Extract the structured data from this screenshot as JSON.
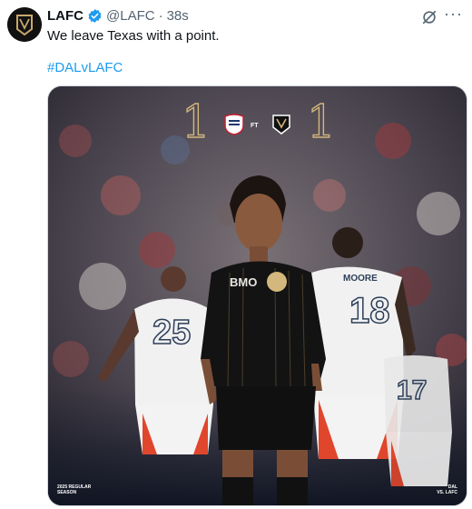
{
  "tweet": {
    "display_name": "LAFC",
    "handle": "@LAFC",
    "separator": "·",
    "time": "38s",
    "text": "We leave Texas with a point.",
    "hashtag": "#DALvLAFC",
    "icons": {
      "avatar": "lafc-logo-icon",
      "verified": "verified-badge-icon",
      "grok": "grok-icon",
      "more": "more-options-icon"
    },
    "colors": {
      "link": "#1d9bf0",
      "verified": "#1d9bf0",
      "muted": "#536471"
    }
  },
  "graphic": {
    "home_score": "1",
    "away_score": "1",
    "status": "FT",
    "home_team_badge": "fc-dallas-badge-icon",
    "away_team_badge": "lafc-badge-icon",
    "sponsor": "BMO",
    "player_numbers": [
      "25",
      "18",
      "17"
    ],
    "player_name": "MOORE",
    "footer_left": [
      "2025 REGULAR",
      "SEASON"
    ],
    "footer_right": [
      "DAL",
      "VS. LAFC"
    ],
    "accent_color": "#d3b77c"
  }
}
